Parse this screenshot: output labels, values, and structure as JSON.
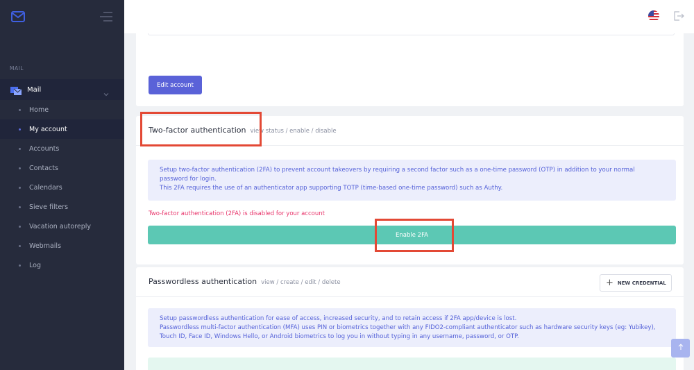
{
  "sidebar": {
    "section_label": "MAIL",
    "group_label": "Mail",
    "items": [
      {
        "label": "Home"
      },
      {
        "label": "My account"
      },
      {
        "label": "Accounts"
      },
      {
        "label": "Contacts"
      },
      {
        "label": "Calendars"
      },
      {
        "label": "Sieve filters"
      },
      {
        "label": "Vacation autoreply"
      },
      {
        "label": "Webmails"
      },
      {
        "label": "Log"
      }
    ],
    "active_index": 1
  },
  "topbar": {
    "language_icon": "us-flag-icon",
    "logout_icon": "logout-icon"
  },
  "account_card": {
    "edit_button": "Edit account"
  },
  "twofa": {
    "title": "Two-factor authentication",
    "subtitle": "view status / enable / disable",
    "info_line1": "Setup two-factor authentication (2FA) to prevent account takeovers by requiring a second factor such as a one-time password (OTP) in addition to your normal password for login.",
    "info_line2": "This 2FA requires the use of an authenticator app supporting TOTP (time-based one-time password) such as Authy.",
    "status": "Two-factor authentication (2FA) is disabled for your account",
    "enable_button": "Enable 2FA"
  },
  "passwordless": {
    "title": "Passwordless authentication",
    "subtitle": "view / create / edit / delete",
    "new_button": "NEW CREDENTIAL",
    "info_line1": "Setup passwordless authentication for ease of access, increased security, and to retain access if 2FA app/device is lost.",
    "info_line2": "Passwordless multi-factor authentication (MFA) uses PIN or biometrics together with any FIDO2-compliant authenticator such as hardware security keys (eg: Yubikey), Touch ID, Face ID, Windows Hello, or Android biometrics to log you in without typing in any username, password, or OTP."
  },
  "colors": {
    "sidebar_bg": "#262b3c",
    "primary": "#5a62d8",
    "success": "#5cc8b4",
    "danger": "#e8356b",
    "highlight": "#e34935"
  }
}
